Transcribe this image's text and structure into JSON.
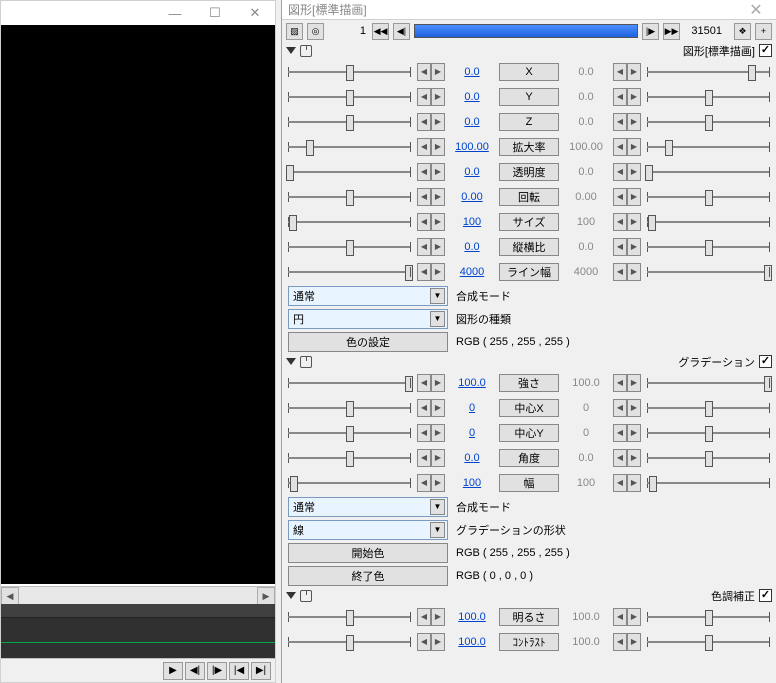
{
  "left": {
    "min": "—",
    "max": "☐",
    "close": "✕"
  },
  "play": {
    "play": "▶",
    "step_back": "◀|",
    "step_fwd": "|▶",
    "to_start": "|◀",
    "to_end": "▶|"
  },
  "dialog": {
    "title": "図形[標準描画]"
  },
  "framebar": {
    "start": "1",
    "end": "31501",
    "fb": "◀◀",
    "sb": "◀|",
    "sf": "|▶",
    "ff": "▶▶",
    "bang": "❖",
    "plus": "+"
  },
  "sec_shape": {
    "label": "図形[標準描画]",
    "params": [
      {
        "lv": "0.0",
        "btn": "X",
        "rv": "0.0",
        "lp": 50,
        "rp": 85
      },
      {
        "lv": "0.0",
        "btn": "Y",
        "rv": "0.0",
        "lp": 50,
        "rp": 50
      },
      {
        "lv": "0.0",
        "btn": "Z",
        "rv": "0.0",
        "lp": 50,
        "rp": 50
      },
      {
        "lv": "100.00",
        "btn": "拡大率",
        "rv": "100.00",
        "lp": 18,
        "rp": 18
      },
      {
        "lv": "0.0",
        "btn": "透明度",
        "rv": "0.0",
        "lp": 2,
        "rp": 2
      },
      {
        "lv": "0.00",
        "btn": "回転",
        "rv": "0.00",
        "lp": 50,
        "rp": 50
      },
      {
        "lv": "100",
        "btn": "サイズ",
        "rv": "100",
        "lp": 4,
        "rp": 4
      },
      {
        "lv": "0.0",
        "btn": "縦横比",
        "rv": "0.0",
        "lp": 50,
        "rp": 50
      },
      {
        "lv": "4000",
        "btn": "ライン幅",
        "rv": "4000",
        "lp": 98,
        "rp": 98
      }
    ],
    "mode_dd": "通常",
    "mode_lbl": "合成モード",
    "kind_dd": "円",
    "kind_lbl": "図形の種類",
    "color_btn": "色の設定",
    "color_lbl": "RGB ( 255 , 255 , 255 )"
  },
  "sec_grad": {
    "label": "グラデーション",
    "params": [
      {
        "lv": "100.0",
        "btn": "強さ",
        "rv": "100.0",
        "lp": 98,
        "rp": 98
      },
      {
        "lv": "0",
        "btn": "中心X",
        "rv": "0",
        "lp": 50,
        "rp": 50
      },
      {
        "lv": "0",
        "btn": "中心Y",
        "rv": "0",
        "lp": 50,
        "rp": 50
      },
      {
        "lv": "0.0",
        "btn": "角度",
        "rv": "0.0",
        "lp": 50,
        "rp": 50
      },
      {
        "lv": "100",
        "btn": "幅",
        "rv": "100",
        "lp": 5,
        "rp": 5
      }
    ],
    "mode_dd": "通常",
    "mode_lbl": "合成モード",
    "shape_dd": "線",
    "shape_lbl": "グラデーションの形状",
    "start_btn": "開始色",
    "start_lbl": "RGB ( 255 , 255 , 255 )",
    "end_btn": "終了色",
    "end_lbl": "RGB ( 0 , 0 , 0 )"
  },
  "sec_color": {
    "label": "色調補正",
    "params": [
      {
        "lv": "100.0",
        "btn": "明るさ",
        "rv": "100.0",
        "lp": 50,
        "rp": 50
      },
      {
        "lv": "100.0",
        "btn": "ｺﾝﾄﾗｽﾄ",
        "rv": "100.0",
        "lp": 50,
        "rp": 50
      }
    ]
  },
  "ar": {
    "l": "◀",
    "r": "▶"
  }
}
